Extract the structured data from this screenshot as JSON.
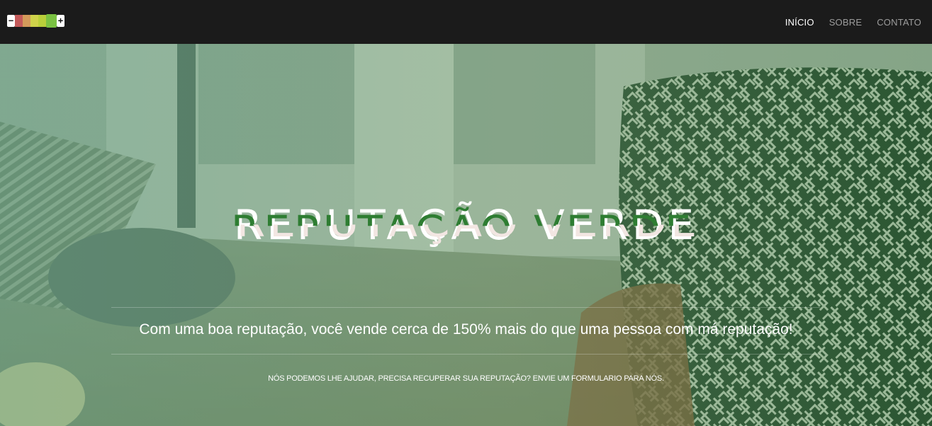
{
  "brand": {
    "minus": "−",
    "plus": "+",
    "segment_colors": [
      "#c45a5a",
      "#d49a5a",
      "#cfd24a",
      "#b9cf3a",
      "#7ac142"
    ]
  },
  "nav": {
    "items": [
      {
        "label": "INÍCIO",
        "active": true
      },
      {
        "label": "SOBRE",
        "active": false
      },
      {
        "label": "CONTATO",
        "active": false
      }
    ]
  },
  "hero": {
    "title": "REPUTAÇÃO VERDE",
    "subtitle": "Com uma boa reputação, você vende cerca de 150% mais do que uma pessoa com má reputação!",
    "cta_prefix": "NÓS PODEMOS LHE AJUDAR, PRECISA RECUPERAR SUA REPUTAÇÃO?",
    "cta_link": "ENVIE UM FORMULARIO PARA NÓS.",
    "accent_color": "#2e7d32"
  }
}
